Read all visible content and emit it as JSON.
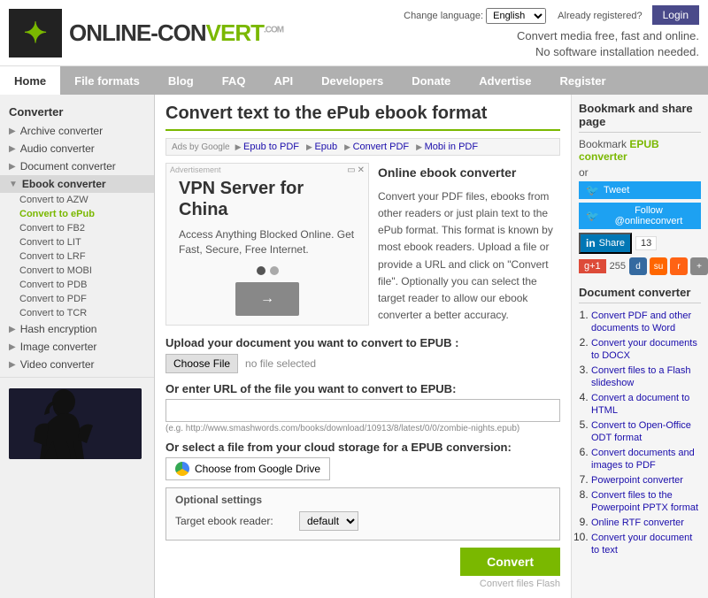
{
  "header": {
    "logo_text": "ONLINE-CONVERT",
    "logo_dot_com": ".COM",
    "tagline_line1": "Convert media free, fast and online.",
    "tagline_line2": "No software installation needed.",
    "lang_label": "Change language:",
    "lang_value": "English",
    "already_registered": "Already registered?",
    "login_btn": "Login"
  },
  "nav": {
    "items": [
      {
        "label": "Home",
        "id": "home",
        "active": false
      },
      {
        "label": "File formats",
        "id": "file-formats",
        "active": false
      },
      {
        "label": "Blog",
        "id": "blog",
        "active": false
      },
      {
        "label": "FAQ",
        "id": "faq",
        "active": false
      },
      {
        "label": "API",
        "id": "api",
        "active": false
      },
      {
        "label": "Developers",
        "id": "developers",
        "active": false
      },
      {
        "label": "Donate",
        "id": "donate",
        "active": false
      },
      {
        "label": "Advertise",
        "id": "advertise",
        "active": false
      },
      {
        "label": "Register",
        "id": "register",
        "active": false
      }
    ]
  },
  "sidebar": {
    "title": "Converter",
    "items": [
      {
        "label": "Archive converter",
        "id": "archive"
      },
      {
        "label": "Audio converter",
        "id": "audio"
      },
      {
        "label": "Document converter",
        "id": "document"
      },
      {
        "label": "Ebook converter",
        "id": "ebook",
        "active": true
      },
      {
        "label": "Hash encryption",
        "id": "hash"
      },
      {
        "label": "Image converter",
        "id": "image"
      },
      {
        "label": "Video converter",
        "id": "video"
      }
    ],
    "ebook_sub": [
      {
        "label": "Convert to AZW",
        "id": "azw"
      },
      {
        "label": "Convert to ePub",
        "id": "epub",
        "active": true
      },
      {
        "label": "Convert to FB2",
        "id": "fb2"
      },
      {
        "label": "Convert to LIT",
        "id": "lit"
      },
      {
        "label": "Convert to LRF",
        "id": "lrf"
      },
      {
        "label": "Convert to MOBI",
        "id": "mobi"
      },
      {
        "label": "Convert to PDB",
        "id": "pdb"
      },
      {
        "label": "Convert to PDF",
        "id": "pdf"
      },
      {
        "label": "Convert to TCR",
        "id": "tcr"
      }
    ]
  },
  "content": {
    "page_title": "Convert text to the ePub ebook format",
    "ad_bar_label": "Ads by Google",
    "ad_bar_links": [
      "Epub to PDF",
      "Epub",
      "Convert PDF",
      "Mobi in PDF"
    ],
    "ad_heading": "VPN Server for China",
    "ad_body": "Access Anything Blocked Online. Get Fast, Secure, Free Internet.",
    "ad_advertisement": "Advertisement",
    "desc_title": "Online ebook converter",
    "desc_text": "Convert your PDF files, ebooks from other readers or just plain text to the ePub format. This format is known by most ebook readers. Upload a file or provide a URL and click on \"Convert file\". Optionally you can select the target reader to allow our ebook converter a better accuracy.",
    "upload_label": "Upload your document you want to convert to EPUB :",
    "choose_file_btn": "Choose File",
    "no_file_text": "no file selected",
    "url_label": "Or enter URL of the file you want to convert to EPUB:",
    "url_placeholder": "",
    "url_hint": "(e.g. http://www.smashwords.com/books/download/10913/8/latest/0/0/zombie-nights.epub)",
    "cloud_label": "Or select a file from your cloud storage for a EPUB conversion:",
    "gdrive_btn": "Choose from Google Drive",
    "settings_title": "Optional settings",
    "target_reader_label": "Target ebook reader:",
    "target_reader_value": "default",
    "convert_btn": "Convert",
    "convert_flash_text": "Convert files Flash"
  },
  "sidebar_right": {
    "bookmark_title": "Bookmark and share page",
    "bookmark_text": "Bookmark",
    "bookmark_link": "EPUB converter",
    "or_text": "or",
    "tweet_btn": "Tweet",
    "follow_btn": "Follow @onlineconvert",
    "share_btn": "Share",
    "share_count": "13",
    "gplus_count": "255",
    "doc_converter_title": "Document converter",
    "doc_items": [
      "Convert PDF and other documents to Word",
      "Convert your documents to DOCX",
      "Convert files to a Flash slideshow",
      "Convert a document to HTML",
      "Convert to Open-Office ODT format",
      "Convert documents and images to PDF",
      "Powerpoint converter",
      "Convert files to the Powerpoint PPTX format",
      "Online RTF converter",
      "Convert your document to text"
    ]
  }
}
